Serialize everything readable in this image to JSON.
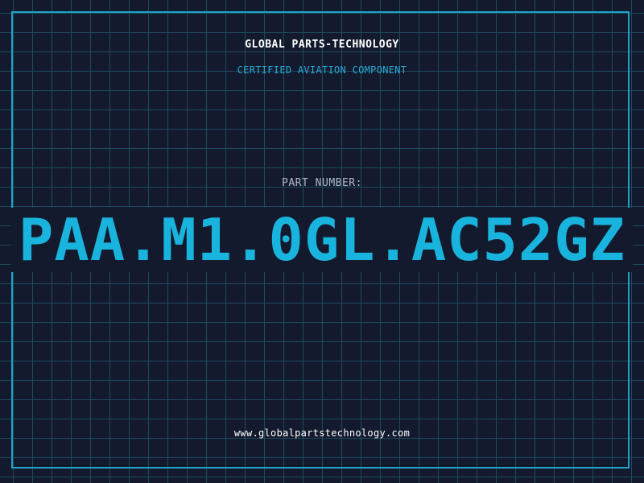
{
  "header": {
    "company": "GLOBAL PARTS-TECHNOLOGY",
    "tagline": "CERTIFIED AVIATION COMPONENT"
  },
  "part": {
    "label": "PART NUMBER:",
    "number": "PAA.M1.0GL.AC52GZ"
  },
  "footer": {
    "website": "www.globalpartstechnology.com"
  },
  "colors": {
    "background": "#141a2e",
    "grid": "#1d4a5c",
    "accent": "#19b4dd",
    "frame": "#1fa3c9"
  }
}
